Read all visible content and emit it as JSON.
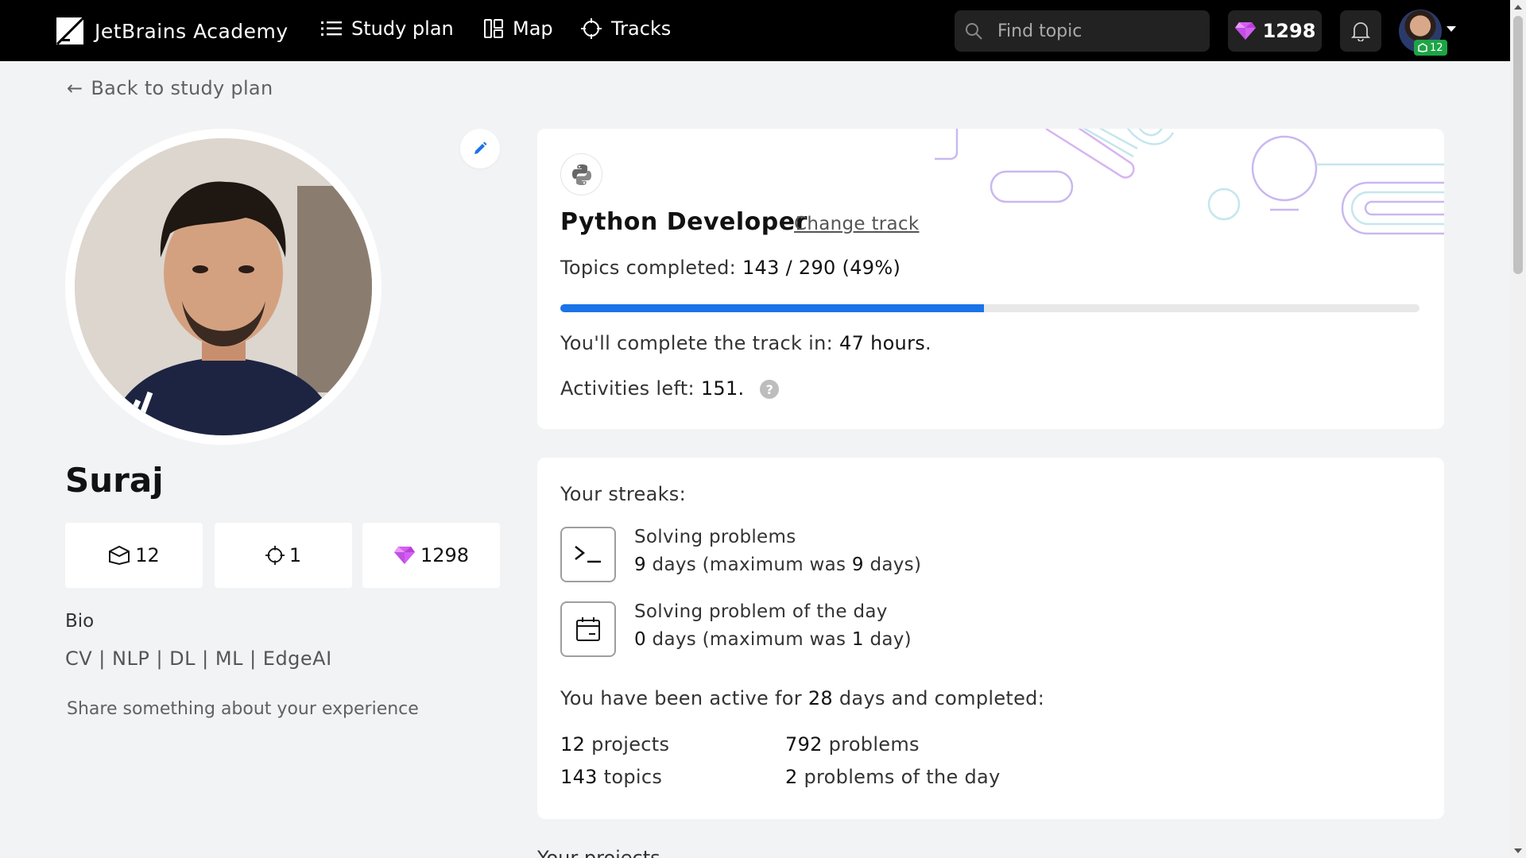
{
  "nav": {
    "brand": "JetBrains Academy",
    "items": [
      {
        "label": "Study plan",
        "icon": "list-icon"
      },
      {
        "label": "Map",
        "icon": "map-icon"
      },
      {
        "label": "Tracks",
        "icon": "crosshair-icon"
      }
    ],
    "search_placeholder": "Find topic",
    "gems": "1298",
    "avatar_badge": "12"
  },
  "back_link": "Back to study plan",
  "profile": {
    "name": "Suraj",
    "stats": [
      {
        "icon": "project-icon",
        "value": "12"
      },
      {
        "icon": "track-icon",
        "value": "1"
      },
      {
        "icon": "gem-icon",
        "value": "1298"
      }
    ],
    "bio_label": "Bio",
    "bio": "CV | NLP | DL | ML | EdgeAI",
    "share_prompt": "Share something about your experience"
  },
  "track": {
    "title": "Python Developer",
    "change_label": "Change track",
    "topics_label": "Topics completed:",
    "topics_value": "143 / 290 (49%)",
    "progress": 0.493,
    "complete_label": "You'll complete the track in:",
    "complete_value": "47 hours",
    "complete_suffix": ".",
    "activities_label": "Activities left:",
    "activities_value": "151.",
    "help": "?"
  },
  "streaks": {
    "title": "Your streaks:",
    "items": [
      {
        "name": "Solving problems",
        "days": "9",
        "days_unit": " days (maximum was ",
        "max": "9",
        "max_unit": " days)"
      },
      {
        "name": "Solving problem of the day",
        "days": "0",
        "days_unit": " days (maximum was ",
        "max": "1",
        "max_unit": " day)"
      }
    ],
    "active_prefix": "You have been active for ",
    "active_days": "28",
    "active_suffix": " days and completed:",
    "totals": [
      {
        "value": "12",
        "label": " projects"
      },
      {
        "value": "143",
        "label": " topics"
      },
      {
        "value": "792",
        "label": " problems"
      },
      {
        "value": "2",
        "label": " problems of the day"
      }
    ]
  },
  "next_section": "Your projects",
  "colors": {
    "accent": "#1a73e8",
    "gem": "#d35ef2",
    "badge": "#1ea446"
  }
}
